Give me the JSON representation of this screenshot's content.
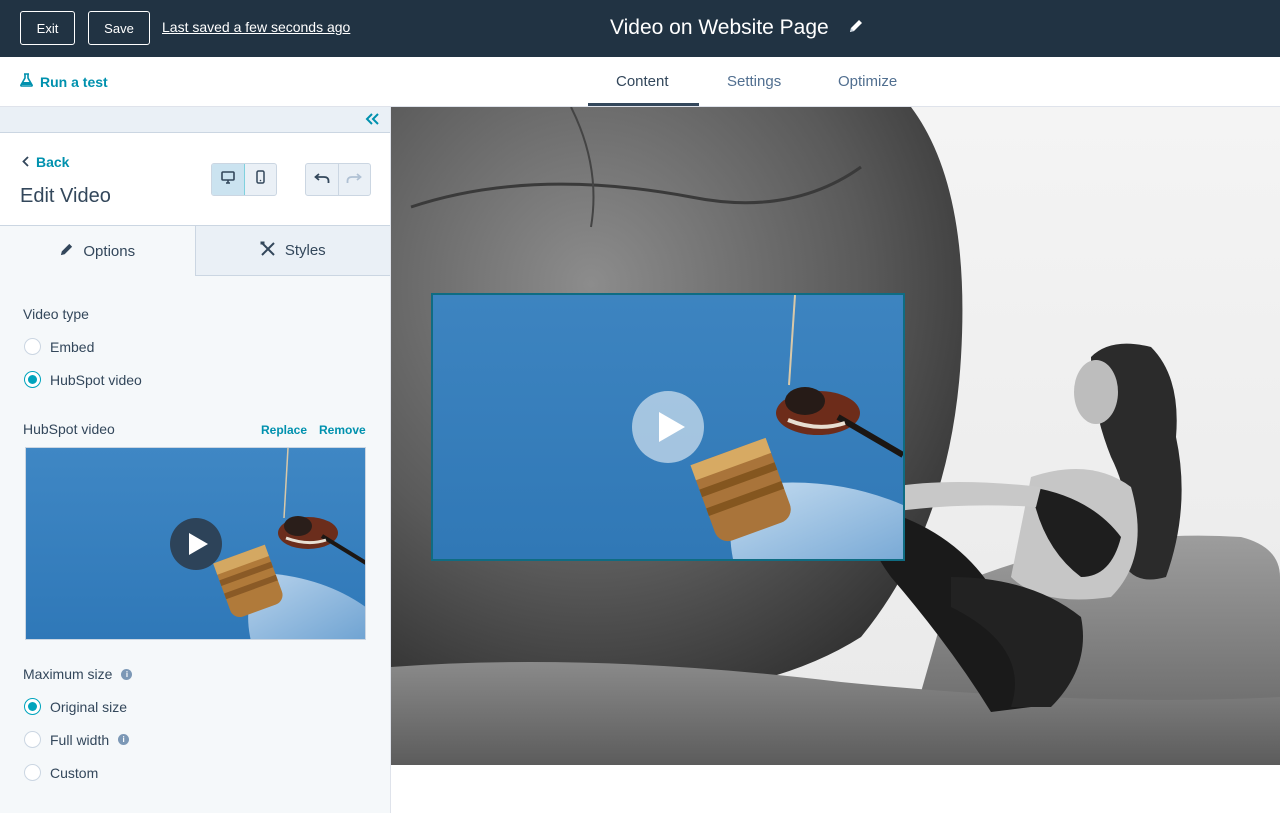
{
  "topbar": {
    "exit_label": "Exit",
    "save_label": "Save",
    "last_saved": "Last saved a few seconds ago",
    "page_title": "Video on Website Page",
    "bg_color": "#213343"
  },
  "subbar": {
    "run_test_label": "Run a test",
    "tabs": [
      {
        "label": "Content",
        "active": true
      },
      {
        "label": "Settings",
        "active": false
      },
      {
        "label": "Optimize",
        "active": false
      }
    ]
  },
  "panel": {
    "back_label": "Back",
    "title": "Edit Video",
    "tabs": [
      {
        "label": "Options",
        "icon": "pencil-icon",
        "active": true
      },
      {
        "label": "Styles",
        "icon": "tools-icon",
        "active": false
      }
    ],
    "video_type": {
      "label": "Video type",
      "options": [
        {
          "label": "Embed",
          "checked": false
        },
        {
          "label": "HubSpot video",
          "checked": true
        }
      ]
    },
    "hubspot_video": {
      "label": "HubSpot video",
      "replace_label": "Replace",
      "remove_label": "Remove"
    },
    "max_size": {
      "label": "Maximum size",
      "options": [
        {
          "label": "Original size",
          "checked": true
        },
        {
          "label": "Full width",
          "checked": false,
          "info": true
        },
        {
          "label": "Custom",
          "checked": false
        }
      ]
    }
  },
  "colors": {
    "accent": "#00a4bd",
    "link": "#0091ae",
    "text": "#33475b",
    "video_sky": "#3a86c2"
  }
}
